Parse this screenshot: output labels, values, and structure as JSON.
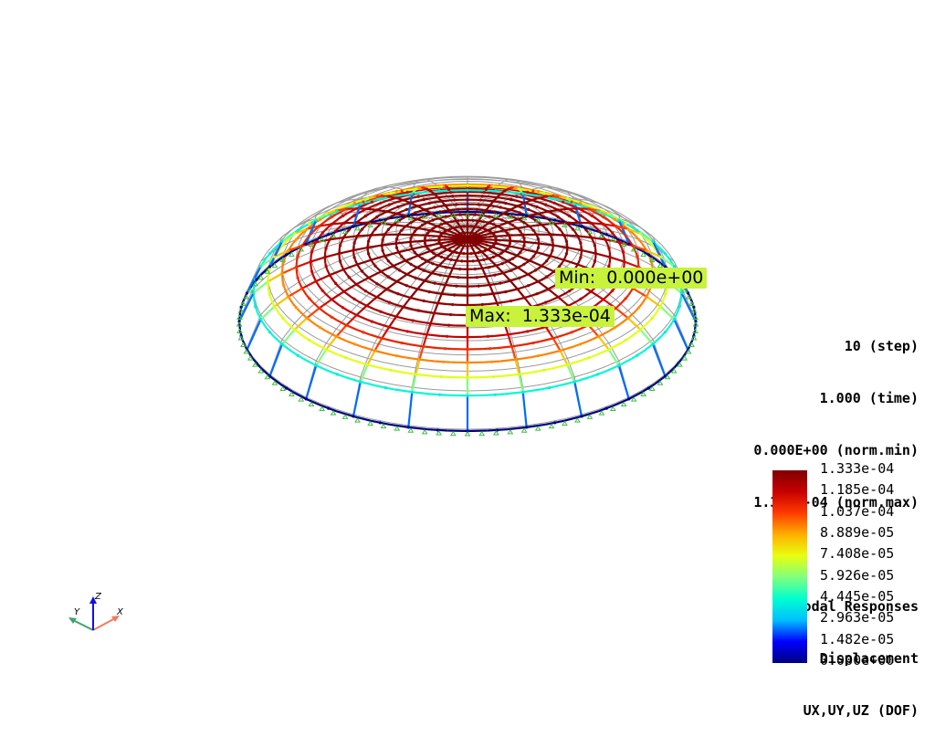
{
  "annotations": {
    "min": "Min:  0.000e+00",
    "max": "Max:  1.333e-04"
  },
  "info": {
    "step": "10 (step)",
    "time": "1.000 (time)",
    "norm_min": "0.000E+00 (norm.min)",
    "norm_max": "1.333E-04 (norm.max)",
    "title1": "Nodal Responses",
    "title2": "Displacement",
    "title3": "UX,UY,UZ (DOF)"
  },
  "colorbar": {
    "ticks": [
      "1.333e-04",
      "1.185e-04",
      "1.037e-04",
      "8.889e-05",
      "7.408e-05",
      "5.926e-05",
      "4.445e-05",
      "2.963e-05",
      "1.482e-05",
      "0.000e+00"
    ],
    "colors": [
      "#000080",
      "#0000ff",
      "#00bfff",
      "#00ffd0",
      "#7fff7f",
      "#e8ff10",
      "#ffb000",
      "#ff3c00",
      "#c80000",
      "#800000"
    ]
  },
  "triad": {
    "x_label": "X",
    "y_label": "Y",
    "z_label": "Z",
    "x_color": "#f07c5c",
    "y_color": "#3fa36a",
    "z_color": "#1010e0"
  }
}
